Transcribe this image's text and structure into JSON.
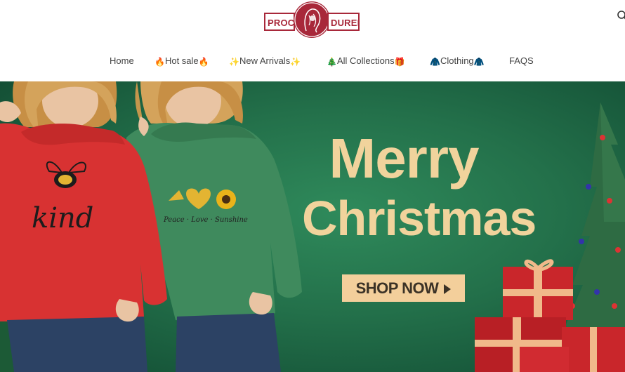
{
  "brand": {
    "logo_left": "PROCE",
    "logo_right": "DUREI",
    "color": "#a8283a"
  },
  "header": {
    "search_icon": "search-icon"
  },
  "nav": {
    "items": [
      {
        "label": "Home",
        "prefix": "",
        "suffix": ""
      },
      {
        "label": "Hot sale",
        "prefix": "🔥",
        "suffix": "🔥"
      },
      {
        "label": "New Arrivals",
        "prefix": "✨",
        "suffix": "✨"
      },
      {
        "label": "All Collections",
        "prefix": "🎄",
        "suffix": "🎁"
      },
      {
        "label": "Clothing",
        "prefix": "🧥",
        "suffix": "🧥"
      },
      {
        "label": "FAQS",
        "prefix": "",
        "suffix": ""
      }
    ]
  },
  "hero": {
    "title_line1": "Merry",
    "title_line2": "Christmas",
    "button_label": "SHOP NOW",
    "left_hoodie_text": "kind",
    "right_hoodie_text": "Peace · Love · Sunshine",
    "background_color": "#23704a",
    "accent_color": "#f3cf9b"
  }
}
